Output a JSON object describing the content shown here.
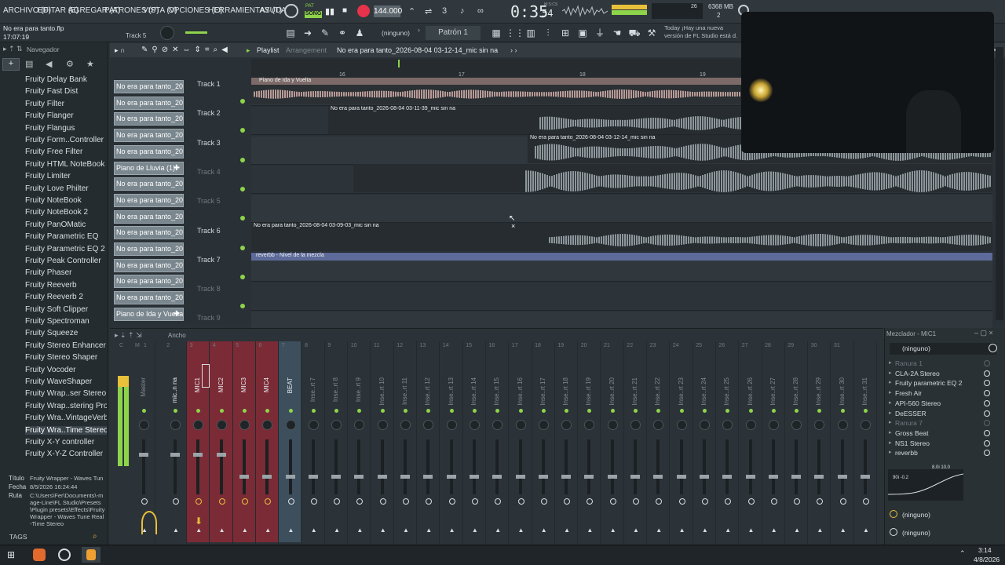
{
  "menu": [
    "ARCHIVO (F)",
    "EDITAR (E)",
    "AGREGAR (A)",
    "PATRONES (P)",
    "VISTA (V)",
    "OPCIONES (O)",
    "HERRAMIENTAS (T)",
    "AYUDA"
  ],
  "transport": {
    "song_mode": "SONG",
    "pat_mode": "PAT",
    "tempo": "144.000",
    "time": "0:35",
    "time_sub": "54",
    "time_unit": "M:S:CS",
    "cpu": "26",
    "memory": "6368 MB",
    "voices": "2"
  },
  "project": {
    "filename": "No era para tanto.flp",
    "time": "17:07:19",
    "track_hint": "Track 5"
  },
  "pattern": {
    "none_label": "(ninguno)",
    "pattern_name": "Patrón 1"
  },
  "news": {
    "line1": "Today ¡Hay una nueva",
    "line2": "versión de FL Studio está d."
  },
  "browser": {
    "title": "Navegador",
    "items": [
      "Fruity Delay Bank",
      "Fruity Fast Dist",
      "Fruity Filter",
      "Fruity Flanger",
      "Fruity Flangus",
      "Fruity Form..Controller",
      "Fruity Free Filter",
      "Fruity HTML NoteBook",
      "Fruity Limiter",
      "Fruity Love Philter",
      "Fruity NoteBook",
      "Fruity NoteBook 2",
      "Fruity PanOMatic",
      "Fruity Parametric EQ",
      "Fruity Parametric EQ 2",
      "Fruity Peak Controller",
      "Fruity Phaser",
      "Fruity Reeverb",
      "Fruity Reeverb 2",
      "Fruity Soft Clipper",
      "Fruity Spectroman",
      "Fruity Squeeze",
      "Fruity Stereo Enhancer",
      "Fruity Stereo Shaper",
      "Fruity Vocoder",
      "Fruity WaveShaper",
      "Fruity Wrap..ser Stereo",
      "Fruity Wrap..stering Pro",
      "Fruity Wra..VintageVerb",
      "Fruity Wra..Time Stereo",
      "Fruity X-Y controller",
      "Fruity X-Y-Z Controller"
    ],
    "selected_index": 29,
    "info_labels": {
      "title": "Título",
      "date": "Fecha",
      "path": "Ruta"
    },
    "info": {
      "title": "Fruity Wrapper - Waves Tun",
      "date": "8/5/2026 16:24:44",
      "path": "C:\\Users\\Fer\\Documents\\-mage-Line\\FL Studio\\Presets\\Plugin presets\\Effects\\Fruity Wrapper - Waves Tune Real-Time Stereo"
    },
    "tags": "TAGS"
  },
  "playlist": {
    "title": "Playlist",
    "subtitle": "Arrangement",
    "clip": "No era para tanto_2026-08-04 03-12-14_mic sin na",
    "ruler": [
      "16",
      "17",
      "18",
      "19"
    ],
    "patterns": [
      "No era para tanto_2026-...",
      "No era para tanto_2026-...",
      "No era para tanto_2026-...",
      "No era para tanto_2026-...",
      "No era para tanto_2026-...",
      "Piano de Lluvia (1)",
      "No era para tanto_2026-...",
      "No era para tanto_2026-...",
      "No era para tanto_2026-...",
      "No era para tanto_2026-...",
      "No era para tanto_2026-...",
      "No era para tanto_2026-...",
      "No era para tanto_2026-...",
      "No era para tanto_2026-...",
      "Piano de Ida y Vuelta"
    ],
    "tracks": [
      "Track 1",
      "Track 2",
      "Track 3",
      "Track 4",
      "Track 5",
      "Track 6",
      "Track 7",
      "Track 8",
      "Track 9"
    ],
    "clips": {
      "t1": "Piano de Ida y Vuelta",
      "t2": "No era para tanto_2026-08-04 03-11-39_mic sin na",
      "t3": "No era para tanto_2026-08-04 03-12-14_mic sin na",
      "t6": "No era para tanto_2026-08-04 03-09-03_mic sin na",
      "t7": "reverbb - Nivel de la mezcla"
    }
  },
  "mixer": {
    "width_label": "Ancho",
    "numbers": [
      "C",
      "M",
      "1",
      "2",
      "3",
      "4",
      "5",
      "6",
      "7",
      "8",
      "9",
      "10",
      "11",
      "12",
      "13",
      "14",
      "15",
      "16",
      "17",
      "18",
      "19",
      "20",
      "21",
      "22",
      "23",
      "24",
      "25",
      "26",
      "27",
      "28",
      "29",
      "30",
      "31"
    ],
    "strips": [
      "Master",
      "mic..n na",
      "MIC1",
      "MIC2",
      "MIC3",
      "MIC4",
      "BEAT",
      "Inse..rt 7",
      "Inse..rt 8",
      "Inse..rt 9",
      "Inse..rt 10",
      "Inse..rt 11",
      "Inse..rt 12",
      "Inse..rt 13",
      "Inse..rt 14",
      "Inse..rt 15",
      "Inse..rt 16",
      "Inse..rt 17",
      "Inse..rt 18",
      "Inse..rt 19",
      "Inse..rt 20",
      "Inse..rt 21",
      "Inse..rt 22",
      "Inse..rt 23",
      "Inse..rt 24",
      "Inse..rt 25",
      "Inse..rt 26",
      "Inse..rt 27",
      "Inse..rt 28",
      "Inse..rt 29",
      "Inse..rt 30",
      "Inse..rt 31"
    ]
  },
  "fx": {
    "title": "Mezclador - MIC1",
    "input": "(ninguno)",
    "slots": [
      {
        "name": "Ranura 1",
        "active": false
      },
      {
        "name": "CLA-2A Stereo",
        "active": true
      },
      {
        "name": "Fruity parametric EQ 2",
        "active": true
      },
      {
        "name": "Fresh Air",
        "active": true
      },
      {
        "name": "API-560 Stereo",
        "active": true
      },
      {
        "name": "DeESSER",
        "active": true
      },
      {
        "name": "Ranura 7",
        "active": false
      },
      {
        "name": "Gross Beat",
        "active": true
      },
      {
        "name": "NS1 Stereo",
        "active": true
      },
      {
        "name": "reverbb",
        "active": true
      }
    ],
    "eq_label1": "8.0i 10.0",
    "eq_label2": "90i -0.2",
    "output1": "(ninguno)",
    "output2": "(ninguno)"
  },
  "taskbar": {
    "time": "3:14",
    "date": "4/8/2026"
  },
  "colors": {
    "accent_green": "#8ed44b",
    "record_red": "#e6324a",
    "clip_pink": "#b89a97",
    "mixer_red": "#8a2a36",
    "mixer_blue": "#3d4f5d"
  }
}
